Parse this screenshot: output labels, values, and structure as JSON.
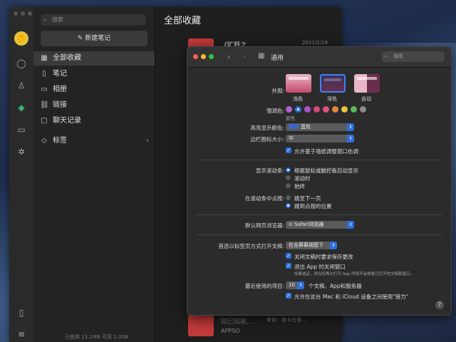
{
  "app": {
    "search_placeholder": "搜索",
    "new_note": "新建笔记",
    "nav": [
      {
        "icon": "grid-icon",
        "glyph": "▦",
        "label": "全部收藏"
      },
      {
        "icon": "note-icon",
        "glyph": "▯",
        "label": "笔记"
      },
      {
        "icon": "photo-icon",
        "glyph": "▭",
        "label": "相册"
      },
      {
        "icon": "link-icon",
        "glyph": "⛓",
        "label": "链接"
      },
      {
        "icon": "chat-icon",
        "glyph": "▢",
        "label": "聊天记录"
      },
      {
        "icon": "tag-icon",
        "glyph": "◇",
        "label": "标签"
      }
    ],
    "storage": "已使用 13.1MB 可用 2.0GB",
    "list_title": "全部收藏",
    "cards": [
      {
        "title": "《旷野之...",
        "date": "2021/2/19",
        "subtitle": ""
      },
      {
        "title": "知已知被,...",
        "date": "",
        "subtitle": "APPSO",
        "extra": "来自：旅卡白语..."
      }
    ],
    "avatar_glyph": "🐥"
  },
  "prefs": {
    "title": "通用",
    "search_placeholder": "搜索",
    "appearance_label": "外观:",
    "themes": [
      "浅色",
      "深色",
      "自动"
    ],
    "accent_label": "强调色:",
    "accent_name": "蓝色",
    "accent_colors": [
      "#b05fcb",
      "#2f6fdc",
      "#a855c8",
      "#d9467a",
      "#e0527a",
      "#e3853a",
      "#e6c33a",
      "#5bb85a",
      "#8c8c8c"
    ],
    "highlight_label": "高亮显示颜色:",
    "highlight_value": "蓝色",
    "sidebar_icon_label": "边栏图标大小:",
    "sidebar_icon_value": "中",
    "wallpaper_tint": "允许基于墙纸调整窗口色调",
    "show_scroll_label": "显示滚动条:",
    "show_scroll_options": [
      "根据鼠标或触控板自动显示",
      "滚动时",
      "始终"
    ],
    "click_scroll_label": "在滚动条中点按:",
    "click_scroll_options": [
      "跳至下一页",
      "跳到点按的位置"
    ],
    "browser_label": "默认网页浏览器:",
    "browser_value": "Safari浏览器",
    "tabs_label": "首选以标签页方式打开文稿:",
    "tabs_value": "在全屏幕视图下",
    "ask_keep": "关闭文稿时要求保存更改",
    "close_windows": "退出 App 时关闭窗口",
    "close_windows_note": "如果选定，则当您再次打开 App 时就不会恢复已打开的文稿和窗口。",
    "recent_label": "最近使用的项目:",
    "recent_value": "10",
    "recent_suffix": "个文稿、App和服务器",
    "handoff": "允许在这台 Mac 和 iCloud 设备之间使用\"接力\""
  }
}
